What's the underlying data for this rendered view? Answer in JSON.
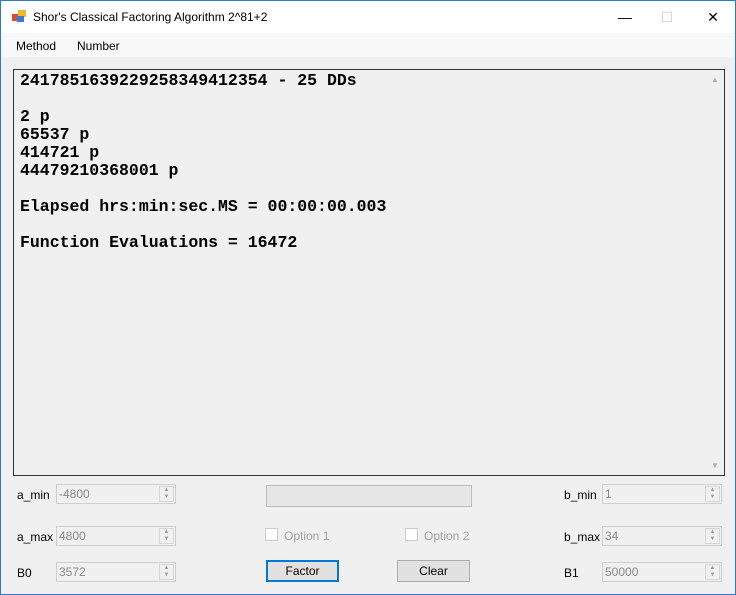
{
  "window": {
    "title": "Shor's Classical Factoring Algorithm 2^81+2",
    "minimize": "—",
    "maximize": "☐",
    "close": "✕"
  },
  "menu": [
    "Method",
    "Number"
  ],
  "output": {
    "lines": [
      "2417851639229258349412354 - 25 DDs",
      "",
      "2 p",
      "65537 p",
      "414721 p",
      "44479210368001 p",
      "",
      "Elapsed hrs:min:sec.MS = 00:00:00.003",
      "",
      "Function Evaluations = 16472"
    ]
  },
  "fields": {
    "a_min": {
      "label": "a_min",
      "value": "-4800"
    },
    "a_max": {
      "label": "a_max",
      "value": "4800"
    },
    "B0": {
      "label": "B0",
      "value": "3572"
    },
    "b_min": {
      "label": "b_min",
      "value": "1"
    },
    "b_max": {
      "label": "b_max",
      "value": "34"
    },
    "B1": {
      "label": "B1",
      "value": "50000"
    }
  },
  "progress": {
    "value": 0
  },
  "options": {
    "option1": {
      "label": "Option 1",
      "checked": false
    },
    "option2": {
      "label": "Option 2",
      "checked": false
    }
  },
  "buttons": {
    "factor": "Factor",
    "clear": "Clear"
  }
}
